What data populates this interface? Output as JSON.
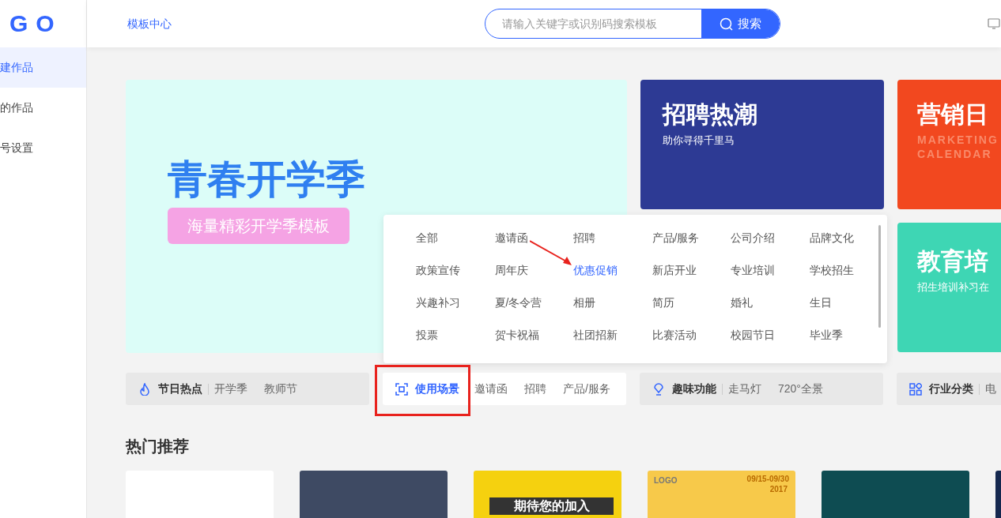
{
  "header": {
    "logo": "GO",
    "nav_link": "模板中心",
    "search": {
      "placeholder": "请输入关键字或识别码搜索模板"
    },
    "search_button": "搜索"
  },
  "sidebar": {
    "items": [
      {
        "label": "建作品",
        "selected": true
      },
      {
        "label": "的作品",
        "selected": false
      },
      {
        "label": "号设置",
        "selected": false
      }
    ]
  },
  "banners": [
    {
      "kind": "hero",
      "title": "青春开学季",
      "subtitle": "海量精彩开学季模板"
    },
    {
      "kind": "recruit",
      "title": "招聘热潮",
      "subtitle": "助你寻得千里马"
    },
    {
      "kind": "marketing",
      "title": "营销日",
      "subtitle": "MARKETING CALENDAR"
    },
    {
      "kind": "education",
      "title": "教育培",
      "subtitle": "招生培训补习在"
    }
  ],
  "category_bars": [
    {
      "title": "节日热点",
      "tags": [
        "开学季",
        "教师节"
      ],
      "selected": false
    },
    {
      "title": "使用场景",
      "tags": [
        "邀请函",
        "招聘",
        "产品/服务"
      ],
      "selected": true
    },
    {
      "title": "趣味功能",
      "tags": [
        "走马灯",
        "720°全景"
      ],
      "selected": false
    },
    {
      "title": "行业分类",
      "tags": [
        "电"
      ],
      "selected": false
    }
  ],
  "dropdown": {
    "items": [
      {
        "label": "全部",
        "selected": false
      },
      {
        "label": "邀请函",
        "selected": false
      },
      {
        "label": "招聘",
        "selected": false
      },
      {
        "label": "产品/服务",
        "selected": false
      },
      {
        "label": "公司介绍",
        "selected": false
      },
      {
        "label": "品牌文化",
        "selected": false
      },
      {
        "label": "政策宣传",
        "selected": false
      },
      {
        "label": "周年庆",
        "selected": false
      },
      {
        "label": "优惠促销",
        "selected": true
      },
      {
        "label": "新店开业",
        "selected": false
      },
      {
        "label": "专业培训",
        "selected": false
      },
      {
        "label": "学校招生",
        "selected": false
      },
      {
        "label": "兴趣补习",
        "selected": false
      },
      {
        "label": "夏/冬令营",
        "selected": false
      },
      {
        "label": "相册",
        "selected": false
      },
      {
        "label": "简历",
        "selected": false
      },
      {
        "label": "婚礼",
        "selected": false
      },
      {
        "label": "生日",
        "selected": false
      },
      {
        "label": "投票",
        "selected": false
      },
      {
        "label": "贺卡祝福",
        "selected": false
      },
      {
        "label": "社团招新",
        "selected": false
      },
      {
        "label": "比赛活动",
        "selected": false
      },
      {
        "label": "校园节日",
        "selected": false
      },
      {
        "label": "毕业季",
        "selected": false
      }
    ]
  },
  "hot": {
    "title": "热门推荐",
    "cards": [
      {
        "kind": "blank"
      },
      {
        "kind": "rabbit"
      },
      {
        "kind": "join",
        "texts": [
          "期待您的加入"
        ]
      },
      {
        "kind": "event",
        "texts": [
          "LOGO",
          "09/15-09/30",
          "2017"
        ]
      },
      {
        "kind": "teal"
      },
      {
        "kind": "dark"
      }
    ]
  }
}
